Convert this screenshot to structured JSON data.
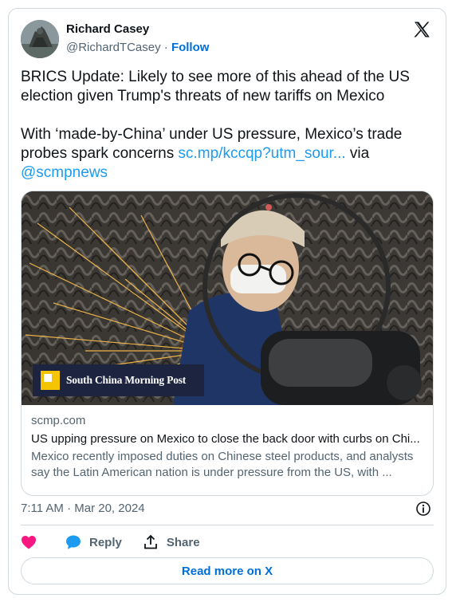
{
  "author": {
    "name": "Richard Casey",
    "handle": "@RichardTCasey",
    "separator": " · ",
    "follow_label": "Follow"
  },
  "platform_icon": "x-logo-icon",
  "tweet": {
    "line1": "BRICS Update: Likely to see more of this ahead of the US election given Trump's threats of new tariffs on Mexico",
    "line2_prefix": "With ‘made-by-China’ under US pressure, Mexico’s trade probes spark concerns ",
    "link_text": "sc.mp/kccqp?utm_sour...",
    "via_text": " via ",
    "mention": "@scmpnews"
  },
  "card": {
    "image_logo_text": "South China Morning Post",
    "domain": "scmp.com",
    "headline": "US upping pressure on Mexico to close the back door with curbs on Chi...",
    "description": "Mexico recently imposed duties on Chinese steel products, and analysts say the Latin American nation is under pressure from the US, with ..."
  },
  "timestamp": "7:11 AM · Mar 20, 2024",
  "actions": {
    "like_icon": "heart-icon",
    "reply_label": "Reply",
    "share_label": "Share"
  },
  "read_more_label": "Read more on X",
  "colors": {
    "link": "#1d9bf0",
    "follow": "#006fd6",
    "heart": "#f91880",
    "reply_bubble": "#1d9bf0",
    "muted": "#536471",
    "border": "#cfd9de"
  }
}
